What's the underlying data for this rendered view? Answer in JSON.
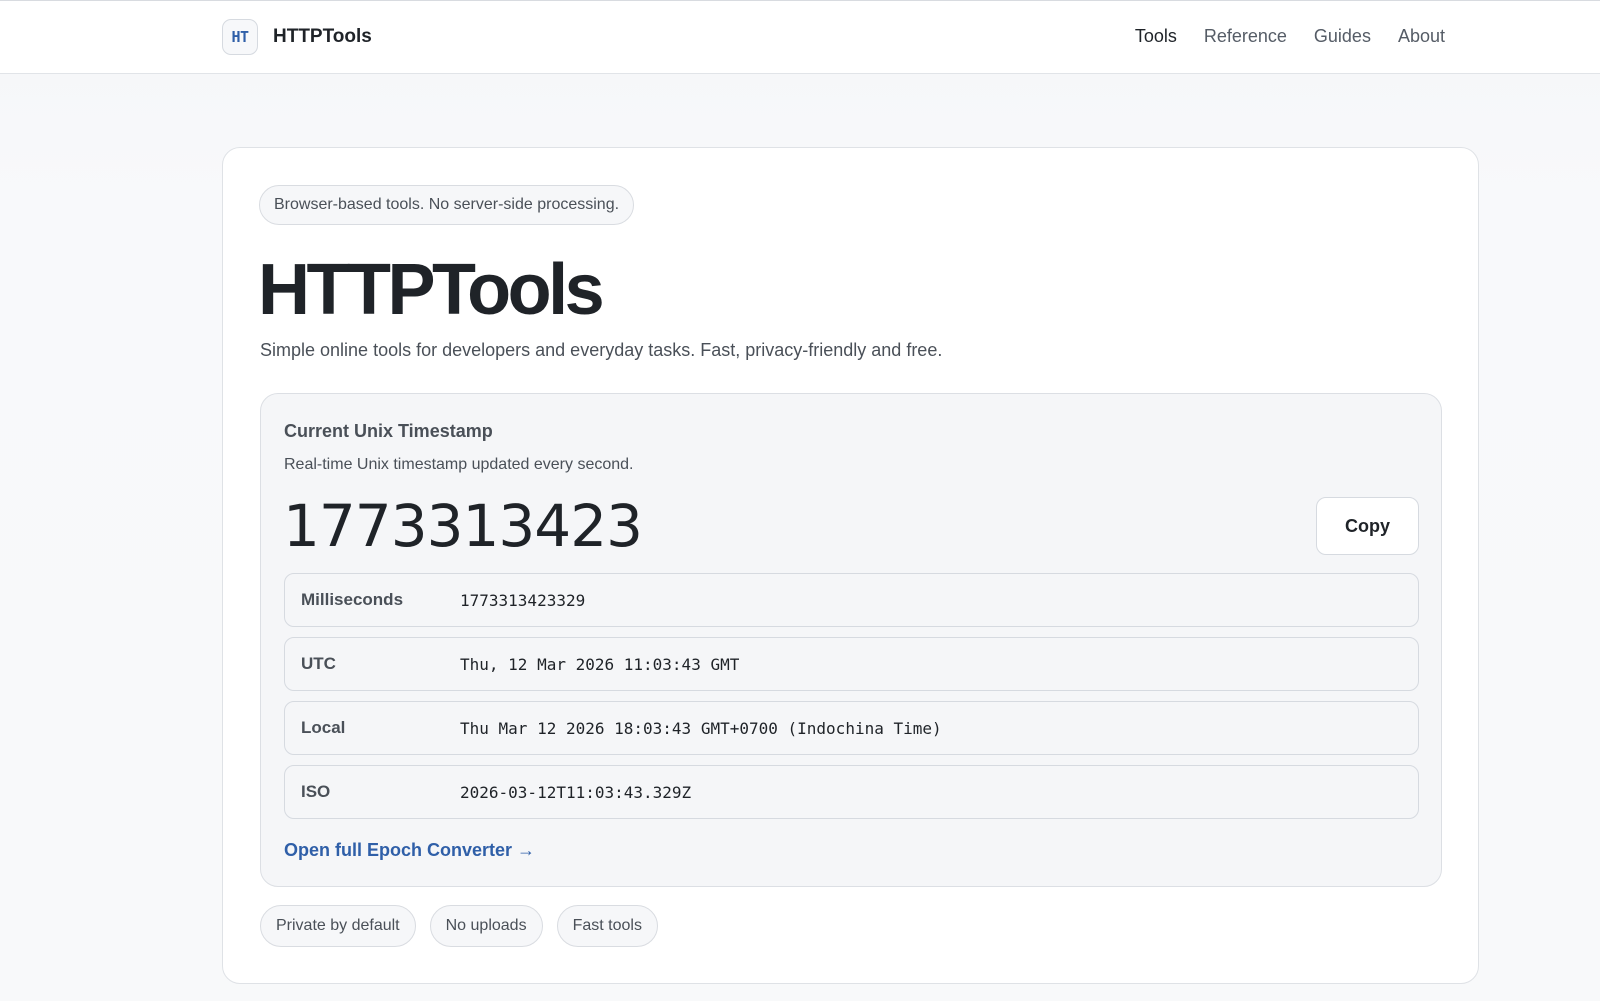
{
  "header": {
    "logo_text": "HT",
    "brand_name": "HTTPTools",
    "nav": [
      {
        "label": "Tools",
        "active": true
      },
      {
        "label": "Reference",
        "active": false
      },
      {
        "label": "Guides",
        "active": false
      },
      {
        "label": "About",
        "active": false
      }
    ]
  },
  "hero": {
    "badge": "Browser-based tools. No server-side processing.",
    "title": "HTTPTools",
    "subtitle": "Simple online tools for developers and everyday tasks. Fast, privacy-friendly and free."
  },
  "timestamp": {
    "title": "Current Unix Timestamp",
    "description": "Real-time Unix timestamp updated every second.",
    "value": "1773313423",
    "copy_label": "Copy",
    "rows": [
      {
        "label": "Milliseconds",
        "value": "1773313423329"
      },
      {
        "label": "UTC",
        "value": "Thu, 12 Mar 2026 11:03:43 GMT"
      },
      {
        "label": "Local",
        "value": "Thu Mar 12 2026 18:03:43 GMT+0700 (Indochina Time)"
      },
      {
        "label": "ISO",
        "value": "2026-03-12T11:03:43.329Z"
      }
    ],
    "link_label": "Open full Epoch Converter →"
  },
  "features": [
    "Private by default",
    "No uploads",
    "Fast tools"
  ],
  "colors": {
    "accent": "#2f5fa8",
    "text": "#1f2328",
    "muted": "#4a5058",
    "border": "#d6dae0"
  }
}
